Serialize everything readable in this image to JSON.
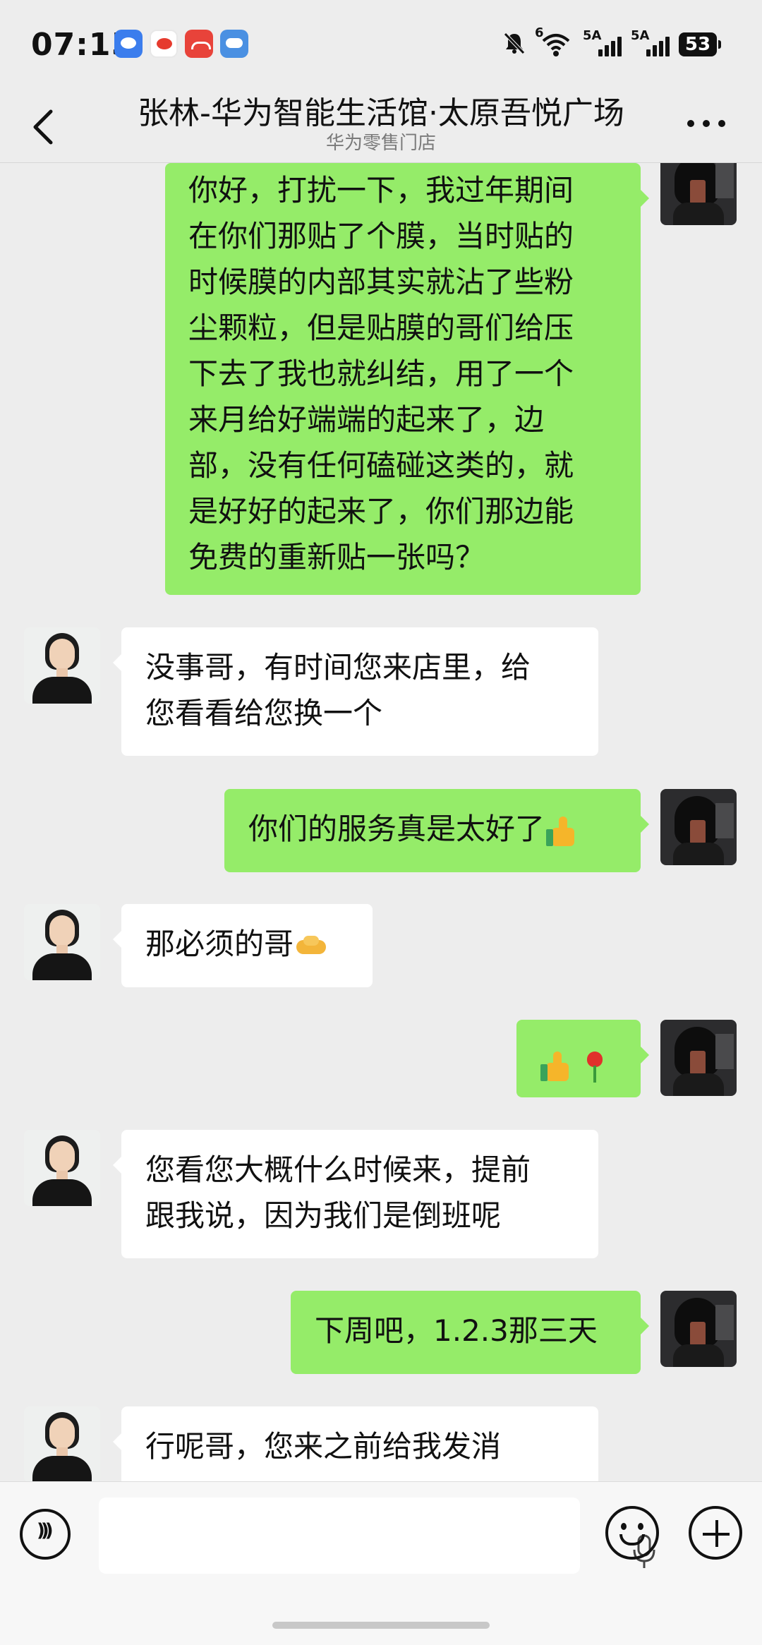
{
  "status_bar": {
    "time": "07:15",
    "signal1_label": "5A",
    "signal2_label": "5A",
    "wifi_label": "6",
    "battery": "53"
  },
  "header": {
    "title": "张林-华为智能生活馆·太原吾悦广场",
    "subtitle": "华为零售门店"
  },
  "messages": [
    {
      "from": "me",
      "lines": [
        "你好，打扰一下，我过年期间",
        "在你们那贴了个膜，当时贴的",
        "时候膜的内部其实就沾了些粉",
        "尘颗粒，但是贴膜的哥们给压",
        "下去了我也就纠结，用了一个",
        "来月给好端端的起来了，边",
        "部，没有任何磕碰这类的，就",
        "是好好的起来了，你们那边能",
        "免费的重新贴一张吗？"
      ]
    },
    {
      "from": "them",
      "lines": [
        "没事哥，有时间您来店里，给",
        "您看看给您换一个"
      ]
    },
    {
      "from": "me",
      "text": "你们的服务真是太好了",
      "emoji": "thumbs-up"
    },
    {
      "from": "them",
      "text": "那必须的哥",
      "emoji": "handshake"
    },
    {
      "from": "me",
      "emojis": [
        "thumbs-up",
        "rose"
      ]
    },
    {
      "from": "them",
      "lines": [
        "您看您大概什么时候来，提前",
        "跟我说，因为我们是倒班呢"
      ]
    },
    {
      "from": "me",
      "text": "下周吧，1.2.3那三天"
    },
    {
      "from": "them",
      "lines": [
        "行呢哥，您来之前给我发消"
      ]
    }
  ],
  "input_bar": {
    "placeholder": ""
  },
  "colors": {
    "background": "#ededed",
    "my_bubble": "#95ec69",
    "their_bubble": "#ffffff"
  }
}
